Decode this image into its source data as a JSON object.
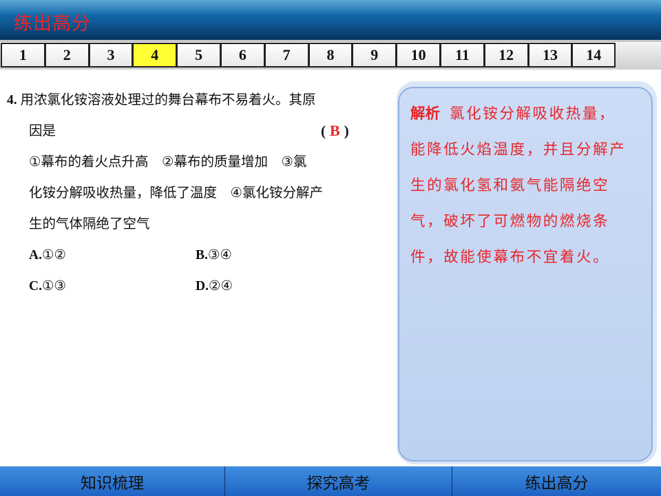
{
  "header": {
    "title": "练出高分"
  },
  "tabs": [
    "1",
    "2",
    "3",
    "4",
    "5",
    "6",
    "7",
    "8",
    "9",
    "10",
    "11",
    "12",
    "13",
    "14"
  ],
  "active_tab": "4",
  "question": {
    "number": "4",
    "line1": "用浓氯化铵溶液处理过的舞台幕布不易着火。其原",
    "line2": "因是",
    "answer_open": "(",
    "answer": "B",
    "answer_close": ")",
    "line3": "①幕布的着火点升高　②幕布的质量增加　③氯",
    "line4": "化铵分解吸收热量，降低了温度　④氯化铵分解产",
    "line5": "生的气体隔绝了空气",
    "options": [
      {
        "letter": "A",
        "sep": ".",
        "text": "①②"
      },
      {
        "letter": "B",
        "sep": ".",
        "text": "③④"
      },
      {
        "letter": "C",
        "sep": ".",
        "text": "①③"
      },
      {
        "letter": "D",
        "sep": ".",
        "text": "②④"
      }
    ]
  },
  "analysis": {
    "label": "解析",
    "line1": "氯化铵分解吸收热量，",
    "line2": "能降低火焰温度，并且分解产",
    "line3": "生的氯化氢和氨气能隔绝空",
    "line4": "气，破坏了可燃物的燃烧条",
    "line5": "件，故能使幕布不宜着火。"
  },
  "bottom_nav": [
    "知识梳理",
    "探究高考",
    "练出高分"
  ],
  "colors": {
    "accent_red": "#e8262a",
    "active_tab": "#ffff33",
    "nav_blue": "#2a74d4"
  }
}
